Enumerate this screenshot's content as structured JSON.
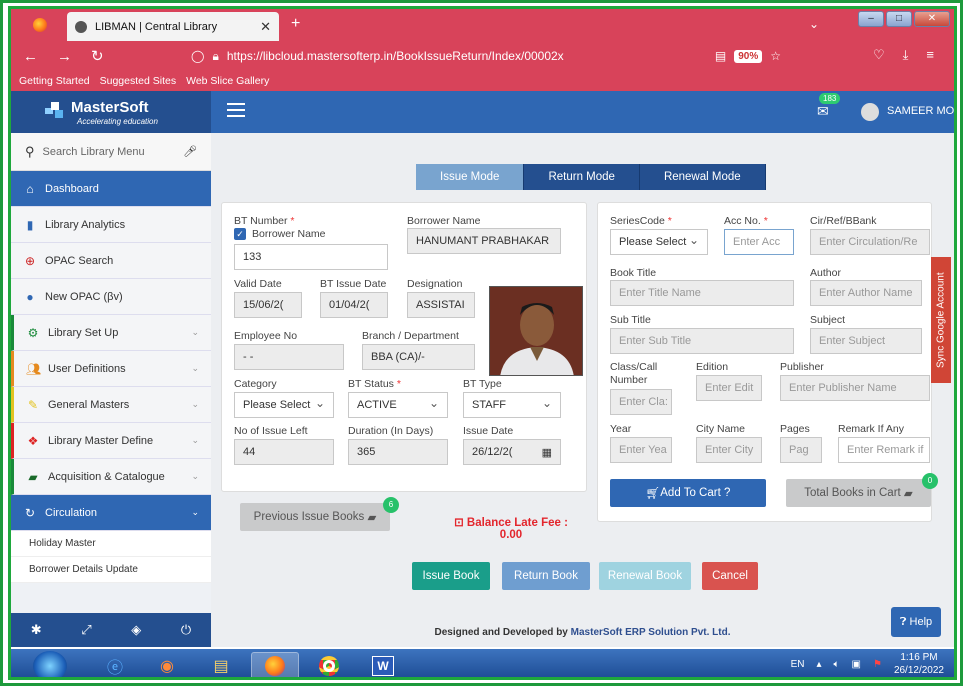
{
  "browser": {
    "tab_title": "LIBMAN | Central Library",
    "url": "https://libcloud.mastersofterp.in/BookIssueReturn/Index/00002x",
    "zoom": "90%",
    "bookmarks": [
      "Getting Started",
      "Suggested Sites",
      "Web Slice Gallery"
    ]
  },
  "header": {
    "brand": "MasterSoft",
    "tagline": "Accelerating education",
    "notif_count": "183",
    "user": "SAMEER MOR"
  },
  "sidebar": {
    "search_placeholder": "Search Library Menu",
    "items": [
      {
        "label": "Dashboard",
        "icon": "home-icon"
      },
      {
        "label": "Library Analytics",
        "icon": "bar-chart-icon"
      },
      {
        "label": "OPAC Search",
        "icon": "search-icon"
      },
      {
        "label": "New OPAC (βv)",
        "icon": "globe-icon"
      },
      {
        "label": "Library Set Up",
        "icon": "gears-icon"
      },
      {
        "label": "User Definitions",
        "icon": "users-icon"
      },
      {
        "label": "General Masters",
        "icon": "edit-icon"
      },
      {
        "label": "Library Master Define",
        "icon": "cubes-icon"
      },
      {
        "label": "Acquisition & Catalogue",
        "icon": "book-icon"
      },
      {
        "label": "Circulation",
        "icon": "refresh-icon"
      }
    ],
    "submenu": [
      "Holiday Master",
      "Borrower Details Update"
    ]
  },
  "modes": [
    "Issue Mode",
    "Return Mode",
    "Renewal Mode"
  ],
  "borrower": {
    "bt_number_label": "BT Number",
    "borrower_name_chk": "Borrower Name",
    "bt_number": "133",
    "borrower_name_label": "Borrower Name",
    "borrower_name": "HANUMANT PRABHAKAR",
    "valid_date_label": "Valid Date",
    "valid_date": "15/06/2(",
    "bt_issue_date_label": "BT Issue Date",
    "bt_issue_date": "01/04/2(",
    "designation_label": "Designation",
    "designation": "ASSISTAI",
    "employee_no_label": "Employee No",
    "employee_no": "- -",
    "branch_label": "Branch / Department",
    "branch": "BBA (CA)/-",
    "category_label": "Category",
    "category": "Please Select",
    "bt_status_label": "BT Status",
    "bt_status": "ACTIVE",
    "bt_type_label": "BT Type",
    "bt_type": "STAFF",
    "issue_left_label": "No of Issue Left",
    "issue_left": "44",
    "duration_label": "Duration (In Days)",
    "duration": "365",
    "issue_date_label": "Issue Date",
    "issue_date": "26/12/2(",
    "prev_books_btn": "Previous Issue Books",
    "prev_books_count": "6",
    "late_fee_label": "Balance Late Fee :",
    "late_fee_value": "0.00"
  },
  "book": {
    "series_label": "SeriesCode",
    "series": "Please Select",
    "acc_label": "Acc No.",
    "acc_ph": "Enter Acc",
    "cir_label": "Cir/Ref/BBank",
    "cir_ph": "Enter Circulation/Re",
    "title_label": "Book Title",
    "title_ph": "Enter Title Name",
    "author_label": "Author",
    "author_ph": "Enter Author Name",
    "subtitle_label": "Sub Title",
    "subtitle_ph": "Enter Sub Title",
    "subject_label": "Subject",
    "subject_ph": "Enter Subject",
    "class_label": "Class/Call Number",
    "class_ph": "Enter Cla:",
    "edition_label": "Edition",
    "edition_ph": "Enter Edit",
    "publisher_label": "Publisher",
    "publisher_ph": "Enter Publisher Name",
    "year_label": "Year",
    "year_ph": "Enter Yea",
    "city_label": "City Name",
    "city_ph": "Enter City",
    "pages_label": "Pages",
    "pages_ph": "Pag",
    "remark_label": "Remark If Any",
    "remark_ph": "Enter Remark if",
    "add_cart_btn": "Add To Cart ?",
    "total_cart_btn": "Total Books in Cart",
    "cart_count": "0"
  },
  "actions": [
    "Issue Book",
    "Return Book",
    "Renewal Book",
    "Cancel"
  ],
  "footer": {
    "prefix": "Designed and Developed by ",
    "company": "MasterSoft ERP Solution Pvt. Ltd."
  },
  "help": "Help",
  "sync": "Sync Google Account",
  "taskbar": {
    "lang": "EN",
    "time": "1:16 PM",
    "date": "26/12/2022"
  },
  "colors": {
    "primary": "#2f67b3",
    "browser": "#d8435a",
    "issue": "#1a9e8a",
    "return": "#6f9ed0",
    "renewal": "#9fd3e0",
    "cancel": "#d9534f"
  }
}
